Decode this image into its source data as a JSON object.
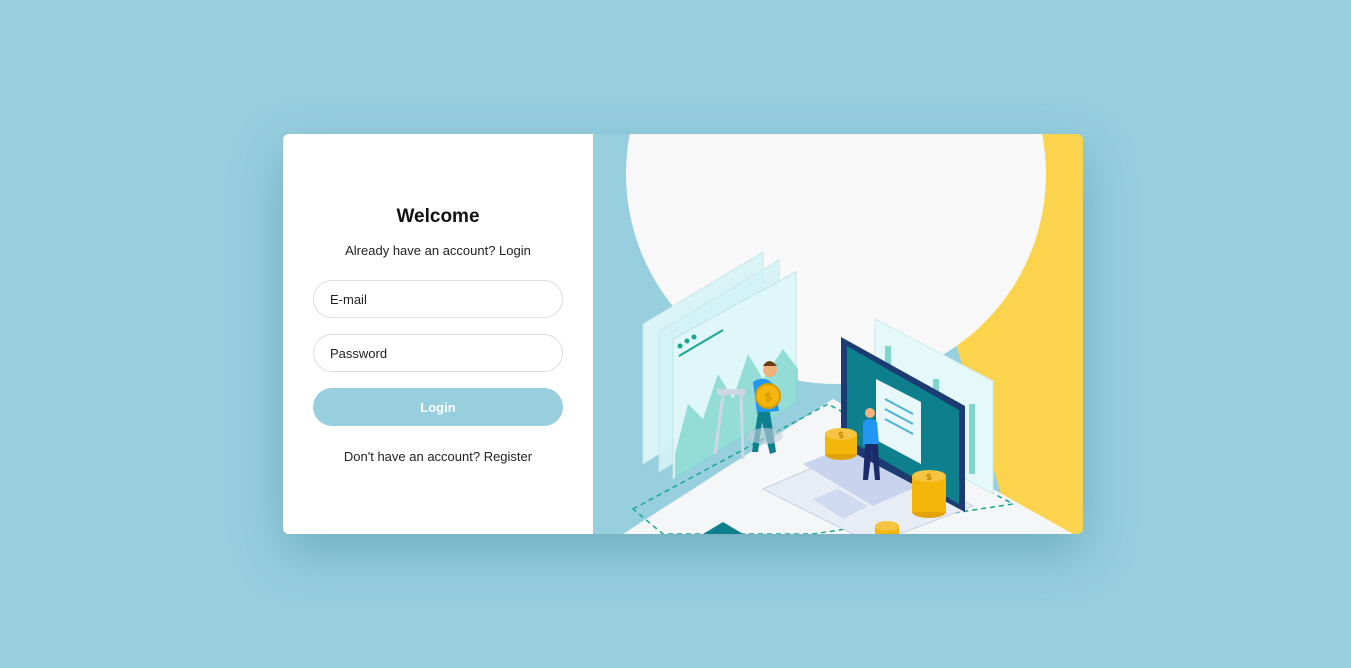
{
  "form": {
    "title": "Welcome",
    "subtitle": "Already have an account? Login",
    "email_placeholder": "E-mail",
    "password_placeholder": "Password",
    "login_label": "Login",
    "register_text": "Don't have an account? Register"
  },
  "colors": {
    "background": "#97cfdf",
    "card": "#ffffff",
    "button": "#97cfdf",
    "accent_yellow": "#fcd34d",
    "accent_teal": "#0e7f8c"
  },
  "illustration": {
    "name": "finance-isometric-illustration"
  }
}
